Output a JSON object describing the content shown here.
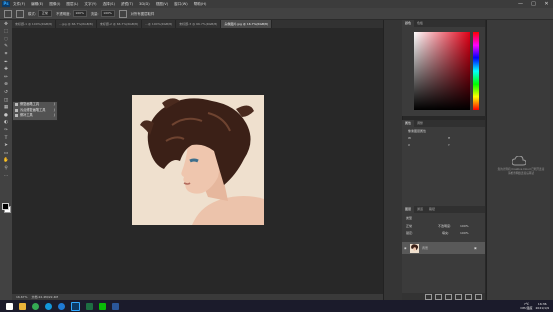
{
  "app": {
    "logo": "Ps"
  },
  "menubar": {
    "items": [
      "文件(F)",
      "编辑(E)",
      "图像(I)",
      "图层(L)",
      "文字(Y)",
      "选择(S)",
      "滤镜(T)",
      "3D(D)",
      "视图(V)",
      "窗口(W)",
      "帮助(H)"
    ],
    "window_controls": [
      "—",
      "□",
      "✕"
    ]
  },
  "options": {
    "mode_label": "模式:",
    "mode_value": "正常",
    "opacity_label": "不透明度:",
    "opacity_value": "100%",
    "flow_label": "流量:",
    "flow_value": "100%",
    "option_label": "对所有图层取样"
  },
  "tabs": [
    {
      "label": "未标题-1 @ 100%(RGB/8)",
      "active": false
    },
    {
      "label": "...jpg @ 66.7%(RGB/8)",
      "active": false
    },
    {
      "label": "未标题-2 @ 66.7%(RGB/8)",
      "active": false
    },
    {
      "label": "...@ 100%(RGB/8)",
      "active": false
    },
    {
      "label": "未标题-3 @ 66.7%(RGB/8)",
      "active": false
    },
    {
      "label": "头像图片.jpg @ 16.7%(RGB/8)",
      "active": true
    }
  ],
  "toolbar": {
    "tools": [
      "move-tool",
      "marquee-tool",
      "lasso-tool",
      "quick-select-tool",
      "crop-tool",
      "eyedropper-tool",
      "healing-brush-tool",
      "brush-tool",
      "clone-stamp-tool",
      "history-brush-tool",
      "eraser-tool",
      "gradient-tool",
      "blur-tool",
      "dodge-tool",
      "pen-tool",
      "type-tool",
      "path-select-tool",
      "shape-tool",
      "hand-tool",
      "zoom-tool",
      "more-tools"
    ]
  },
  "tool_glyphs": [
    "✥",
    "⬚",
    "◌",
    "✎",
    "⌗",
    "✒",
    "✚",
    "✏",
    "⊕",
    "↺",
    "◫",
    "▦",
    "●",
    "◐",
    "✑",
    "T",
    "➤",
    "▭",
    "✋",
    "⚲",
    "…"
  ],
  "flyout": {
    "items": [
      {
        "label": "修复画笔工具",
        "key": "J"
      },
      {
        "label": "污点修复画笔工具",
        "key": "J"
      },
      {
        "label": "修补工具",
        "key": "J"
      }
    ]
  },
  "status": {
    "zoom": "16.67%",
    "doc": "文档:22.4M/22.4M"
  },
  "color_panel": {
    "tabs": [
      "颜色",
      "色板"
    ]
  },
  "properties_panel": {
    "tabs": [
      "属性",
      "调整"
    ],
    "title": "像素图层属性",
    "w_label": "W",
    "w_value": "",
    "h_label": "H",
    "h_value": "",
    "x_label": "X",
    "x_value": "",
    "y_label": "Y",
    "y_value": ""
  },
  "layers_panel": {
    "tabs": [
      "图层",
      "通道",
      "路径"
    ],
    "kind_label": "类型",
    "blend_mode": "正常",
    "opacity_label": "不透明度:",
    "opacity_value": "100%",
    "lock_label": "锁定:",
    "fill_label": "填充:",
    "fill_value": "100%",
    "layer_name": "背景"
  },
  "right_area": {
    "message_line1": "您的计算机 Creative Cloud 已断开连接",
    "message_line2": "请检查网络连接后再试"
  },
  "taskbar": {
    "icons": [
      "start-icon",
      "file-explorer-icon",
      "chrome-icon",
      "qq-icon",
      "edge-icon",
      "photoshop-icon",
      "excel-icon",
      "wechat-icon",
      "word-icon"
    ],
    "colors": [
      "#ffffff",
      "#e8b23a",
      "#34a853",
      "#1296db",
      "#1f7ad6",
      "#31a8ff",
      "#1d6f42",
      "#09bb07",
      "#2b579a"
    ],
    "temperature": "7℃",
    "weather": "CPU温度",
    "time": "16:36",
    "date": "2021/1/9"
  }
}
